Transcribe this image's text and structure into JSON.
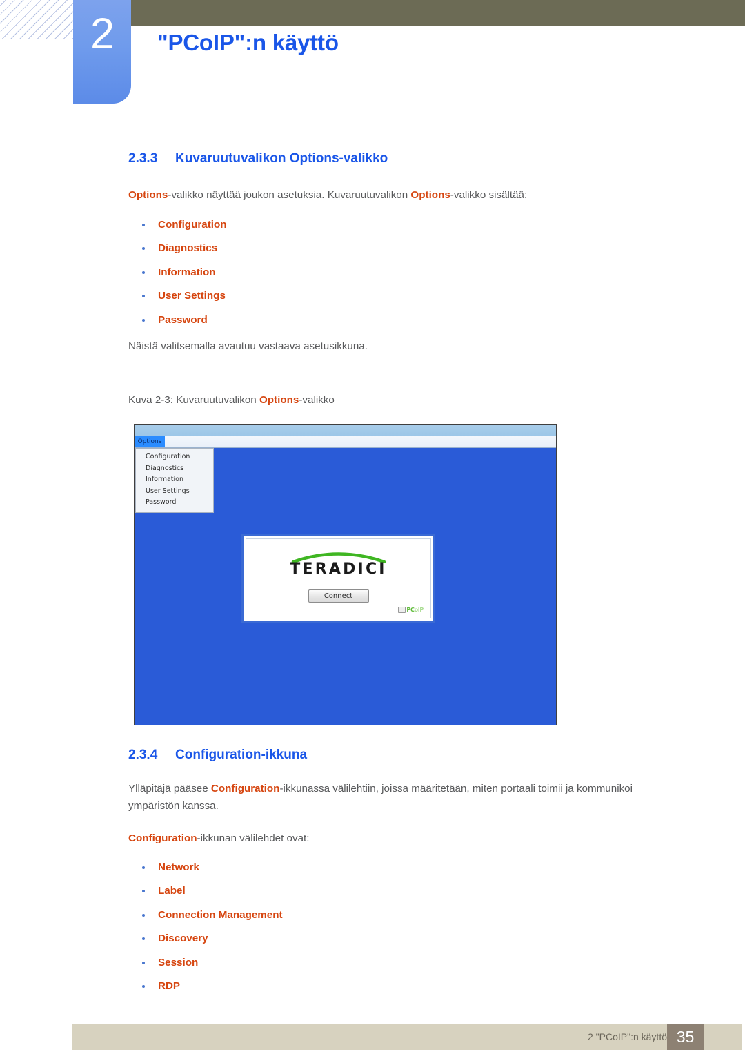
{
  "header": {
    "chapter_number": "2",
    "chapter_title": "\"PCoIP\":n käyttö"
  },
  "sections": [
    {
      "number": "2.3.3",
      "title": "Kuvaruutuvalikon Options-valikko"
    },
    {
      "number": "2.3.4",
      "title": "Configuration-ikkuna"
    }
  ],
  "paragraphs": {
    "intro_pre": "",
    "intro_hl1": "Options",
    "intro_mid": "-valikko näyttää joukon asetuksia. Kuvaruutuvalikon ",
    "intro_hl2": "Options",
    "intro_post": "-valikko sisältää:",
    "after_list": "Näistä valitsemalla avautuu vastaava asetusikkuna.",
    "figure_caption_pre": "Kuva 2-3: Kuvaruutuvalikon ",
    "figure_caption_hl": "Options",
    "figure_caption_post": "-valikko",
    "config_pre": "Ylläpitäjä pääsee ",
    "config_hl": "Configuration",
    "config_post": "-ikkunassa välilehtiin, joissa määritetään, miten portaali toimii ja kommunikoi ympäristön kanssa.",
    "tabs_intro_hl": "Configuration",
    "tabs_intro_post": "-ikkunan välilehdet ovat:"
  },
  "options_menu_items": [
    "Configuration",
    "Diagnostics",
    "Information",
    "User Settings",
    "Password"
  ],
  "configuration_tabs": [
    "Network",
    "Label",
    "Connection Management",
    "Discovery",
    "Session",
    "RDP"
  ],
  "figure": {
    "menubar_button": "Options",
    "dropdown_items": [
      "Configuration",
      "Diagnostics",
      "Information",
      "User Settings",
      "Password"
    ],
    "dialog": {
      "logo_text": "TERADICI",
      "connect_button": "Connect",
      "badge_text_bold": "PC",
      "badge_text_dim": "oIP"
    }
  },
  "footer": {
    "text": "2 \"PCoIP\":n käyttö",
    "page_number": "35"
  },
  "colors": {
    "heading_blue": "#1a56e8",
    "accent_orange": "#d6450f",
    "body_gray": "#58595b",
    "olive": "#6c6b55",
    "footer_beige": "#d7d2bf",
    "footer_taupe": "#8d8173",
    "osd_blue": "#2a5bd7"
  }
}
